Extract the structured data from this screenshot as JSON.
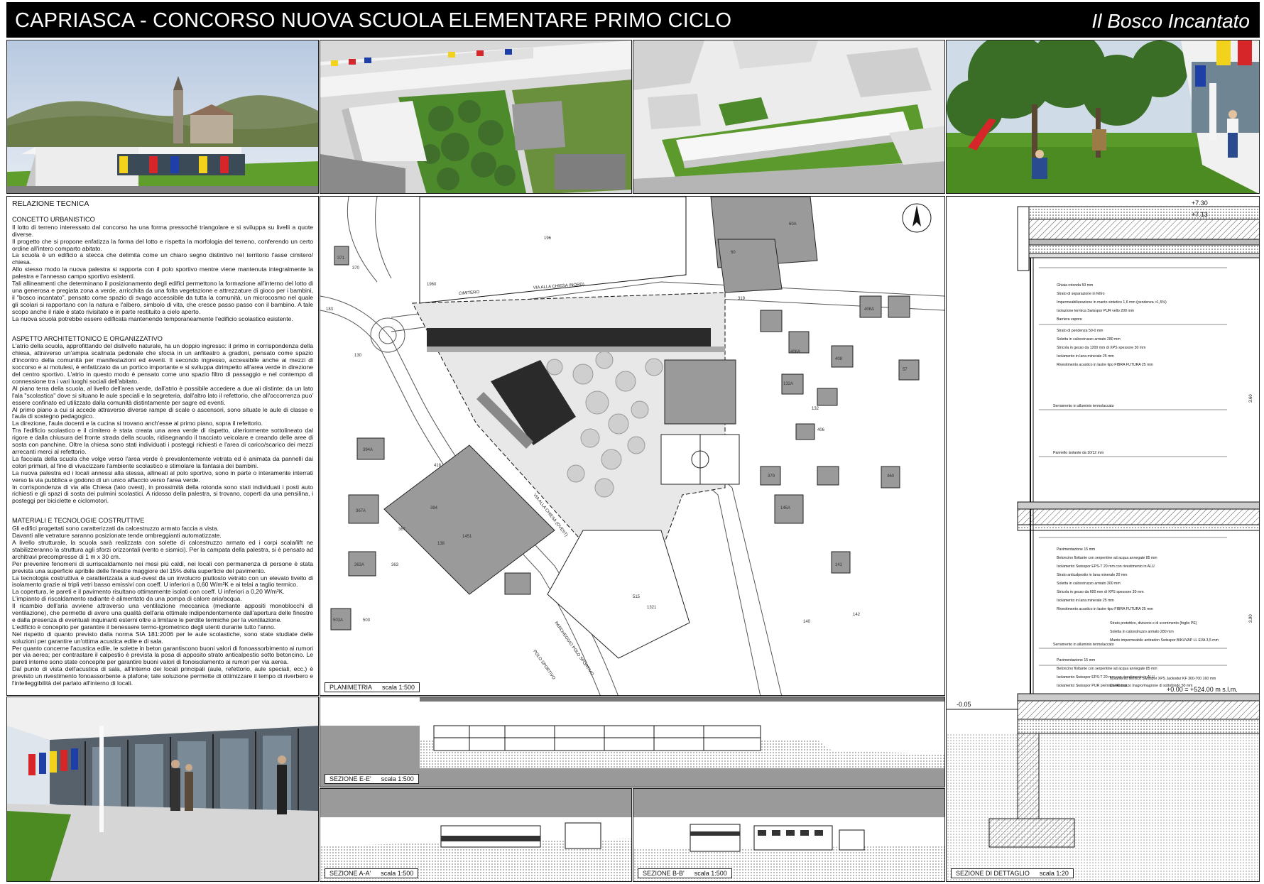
{
  "header": {
    "title": "CAPRIASCA - CONCORSO NUOVA SCUOLA ELEMENTARE PRIMO CICLO",
    "motto": "Il Bosco Incantato"
  },
  "report": {
    "heading": "RELAZIONE TECNICA",
    "sections": [
      {
        "title": "CONCETTO URBANISTICO",
        "paragraphs": [
          "Il lotto di terreno interessato dal concorso ha una forma pressoché triangolare e si sviluppa su livelli a quote diverse.",
          "Il progetto che si propone enfatizza la forma del lotto e rispetta la morfologia del terreno, conferendo un certo ordine all'intero comparto abitato.",
          "La scuola è un edificio a stecca che delimita come un chiaro segno distintivo nel territorio l'asse cimitero/ chiesa.",
          "Allo stesso modo la nuova palestra si rapporta con il polo sportivo mentre viene mantenuta integralmente la palestra e l'annesso campo sportivo esistenti.",
          "Tali allineamenti che determinano il posizionamento degli edifici permettono la formazione all'interno del lotto di una generosa e pregiata zona a verde, arricchita da una folta vegetazione e attrezzature di gioco per i bambini, il \"bosco incantato\", pensato come spazio di svago accessibile da tutta la comunità, un microcosmo nel quale gli scolari si rapportano con la natura e l'albero, simbolo di vita, che cresce passo passo con il bambino. A tale scopo anche il riale è stato rivisitato e in parte restituito a cielo aperto.",
          "La nuova scuola potrebbe essere edificata mantenendo temporaneamente l'edificio scolastico esistente."
        ]
      },
      {
        "title": "ASPETTO ARCHITETTONICO E ORGANIZZATIVO",
        "paragraphs": [
          "L'atrio della scuola, approfittando del dislivello naturale, ha un doppio ingresso: il primo in corrispondenza della chiesa, attraverso un'ampia scalinata pedonale che sfocia in un anfiteatro a gradoni, pensato come spazio d'incontro della comunità per manifestazioni ed eventi. Il secondo ingresso, accessibile anche ai mezzi di soccorso e ai motulesi, è enfatizzato da un portico importante e si sviluppa dirimpetto all'area verde in direzione del centro sportivo. L'atrio in questo modo è pensato come uno spazio filtro di passaggio e nel contempo di connessione tra i vari luoghi sociali dell'abitato.",
          "Al piano terra della scuola, al livello dell'area verde, dall'atrio è possibile accedere a due ali distinte: da un lato l'ala \"scolastica\" dove si situano le aule speciali e la segreteria, dall'altro lato il refettorio, che all'occorrenza puo' essere confinato ed utilizzato dalla comunità distintamente per sagre ed eventi.",
          "Al primo piano a cui si accede attraverso diverse rampe di scale o ascensori, sono situate le aule di classe e l'aula di sostegno pedagogico.",
          "La direzione, l'aula docenti e la cucina si trovano anch'esse al primo piano, sopra il refettorio.",
          "Tra l'edificio scolastico e il cimitero è stata creata una area verde di rispetto, ulteriormente sottolineato dal rigore e dalla chiusura del fronte strada della scuola, ridisegnando il tracciato veicolare e creando delle aree di sosta con panchine. Oltre la chiesa sono stati individuati i posteggi richiesti e l'area di carico/scarico dei mezzi arrecanti merci al refettorio.",
          "La facciata della scuola che volge verso l'area verde è prevalentemente vetrata ed è animata da pannelli dai colori primari, al fine di vivacizzare l'ambiente scolastico e stimolare la fantasia dei bambini.",
          "La nuova palestra ed i locali annessi alla stessa, allineati al polo sportivo, sono in parte o interamente interrati verso la via pubblica e godono di un unico affaccio verso l'area verde.",
          "In corrispondenza di via alla Chiesa (lato ovest), in prossimità della rotonda sono stati individuati i posti auto richiesti e gli spazi di sosta dei pulmini scolastici. A ridosso della palestra, si trovano, coperti da una pensilina, i posteggi per biciclette e ciclomotori."
        ]
      },
      {
        "title": "MATERIALI E TECNOLOGIE COSTRUTTIVE",
        "paragraphs": [
          "Gli edifici progettati sono caratterizzati da calcestruzzo armato faccia a vista.",
          "Davanti alle vetrature saranno posizionate tende ombreggianti automatizzate.",
          "A livello strutturale, la scuola sarà realizzata con solette di calcestruzzo armato ed i corpi scala/lift ne stabilizzeranno la struttura agli sforzi orizzontali (vento e sismici). Per la campata della palestra, si è pensato ad architravi precompresse di 1 m x 30 cm.",
          "Per prevenire fenomeni di surriscaldamento nei mesi più caldi, nei locali con permanenza di persone è stata prevista una superficie apribile delle finestre maggiore del 15% della superficie del pavimento.",
          "La tecnologia costruttiva è caratterizzata a sud-ovest da un involucro piuttosto vetrato con un elevato livello di isolamento grazie ai tripli vetri basso emissivi con coeff. U inferiori a 0,60 W/m²K e ai telai a taglio termico.",
          "La copertura, le pareti e il pavimento risultano ottimamente isolati con coeff. U inferiori a 0,20 W/m²K.",
          "L'impianto di riscaldamento radiante è alimentato da una pompa di calore aria/acqua.",
          "Il ricambio dell'aria avviene attraverso una ventilazione meccanica (mediante appositi monoblocchi di ventilazione), che permette di avere una qualità dell'aria ottimale indipendentemente dall'apertura delle finestre e dalla presenza di eventuali inquinanti esterni oltre a limitare le perdite termiche per la ventilazione.",
          "L'edificio è concepito per garantire il benessere termo-igrometrico degli utenti durante tutto l'anno.",
          "Nel rispetto di quanto previsto dalla norma SIA 181:2006 per le aule scolastiche, sono state studiate delle soluzioni per garantire un'ottima acustica edile e di sala.",
          "Per quanto concerne l'acustica edile, le solette in beton garantiscono buoni valori di fonoassorbimento ai rumori per via aerea; per contrastare il calpestio è prevista la posa di apposito strato anticalpestio sotto betoncino. Le pareti interne sono state concepite per garantire buoni valori di fonoisolamento ai rumori per via aerea.",
          "Dal punto di vista dell'acustica di sala, all'interno dei locali principali (aule, refettorio, aule speciali, ecc.) è previsto un rivestimento fonoassorbente a plafone; tale soluzione permette di ottimizzare il tempo di riverbero e l'intelleggibilità del parlato all'interno di locali."
        ]
      }
    ]
  },
  "plan": {
    "label": "PLANIMETRIA",
    "scale": "scala 1:500",
    "streets": [
      "VIA ALLA CHIESA (NORD)",
      "VIA ALLA CHIESA (OVEST)",
      "CIMITERO",
      "PARCHEGGIO POLO SPORTIVO",
      "POLO SPORTIVO"
    ],
    "parcels": [
      "196",
      "1960",
      "371",
      "370",
      "183",
      "130",
      "418",
      "394A",
      "394",
      "367A",
      "367",
      "363A",
      "363",
      "503A",
      "503",
      "1451",
      "138",
      "515",
      "1321",
      "60",
      "60A",
      "319",
      "408",
      "408A",
      "132A",
      "132",
      "406A",
      "406",
      "57",
      "379",
      "460",
      "141",
      "140",
      "142",
      "145A"
    ]
  },
  "sections": {
    "ee": {
      "label": "SEZIONE E-E'",
      "scale": "scala 1:500"
    },
    "aa": {
      "label": "SEZIONE A-A'",
      "scale": "scala 1:500"
    },
    "bb": {
      "label": "SEZIONE B-B'",
      "scale": "scala 1:500"
    },
    "detail": {
      "label": "SEZIONE DI DETTAGLIO",
      "scale": "scala 1:20"
    }
  },
  "detail": {
    "levels": [
      "+7.30",
      "+7.13",
      "-0.05",
      "+0.00 = +524.00 m s.l.m."
    ],
    "dims": [
      "3.60",
      "3.90"
    ],
    "layers_roof": [
      "Ghiaia rotonda 50 mm",
      "Strato di separazione in feltro",
      "Impermeabilizzazione in manto sintetico 1,6 mm (pendenza >1,5%)",
      "Isolazione termica Swisspor PUR vello 200 mm",
      "Barriera vapore",
      "Strato di pendenza 50-0 mm",
      "Soletta in calcestruzzo armato 280 mm",
      "Stricola in gesso da 1200 mm di XPS spessore 30 mm",
      "Isolamento in lana minerale 25 mm",
      "Rivestimento acustico in lastre tipo FIBRA FUTURA 25 mm"
    ],
    "window_1": "Serramento in alluminio termolaccato",
    "panel": "Pannello isolante da 10/12 mm",
    "layers_floor1": [
      "Pavimentazione 15 mm",
      "Betoncino flottante con serpentine ad acqua annegate 85 mm",
      "Isolamento Swisspor EPS-T 20 mm con rivestimento in ALU",
      "Strato anticalpestio in lana minerale 20 mm",
      "Soletta in calcestruzzo armato 300 mm",
      "Stricola in gesso da 600 mm di XPS spessore 30 mm",
      "Isolamento in lana minerale 25 mm",
      "Rivestimento acustico in lastre tipo FIBRA FUTURA 25 mm"
    ],
    "window_2": "Serramento in alluminio termolaccato",
    "layers_ground": [
      "Pavimentazione 15 mm",
      "Betoncino flottante con serpentine ad acqua annegate 85 mm",
      "Isolamento Swisspor EPS-T 20 mm con rivestimento in ALU",
      "Isolamento Swisspor PUR premium 40 mm",
      "Manto impermeabile antiradon Swisspor BIKUVAP LL EVA 3,5 mm",
      "Soletta in calcestruzzo armato 280 mm",
      "Strato protettivo, divisorio e di scorrimento (foglio PE)",
      "Isolamento termico Swisspor XPS Jackodur KF 300-700 160 mm",
      "Calcestruzzo magro/magrone di sottofondo 50 mm"
    ]
  },
  "colors": {
    "red": "#d7262a",
    "blue": "#1f3fa8",
    "yellow": "#f2d21a",
    "grass": "#5f9e2c",
    "sky": "#d7e1ee"
  }
}
